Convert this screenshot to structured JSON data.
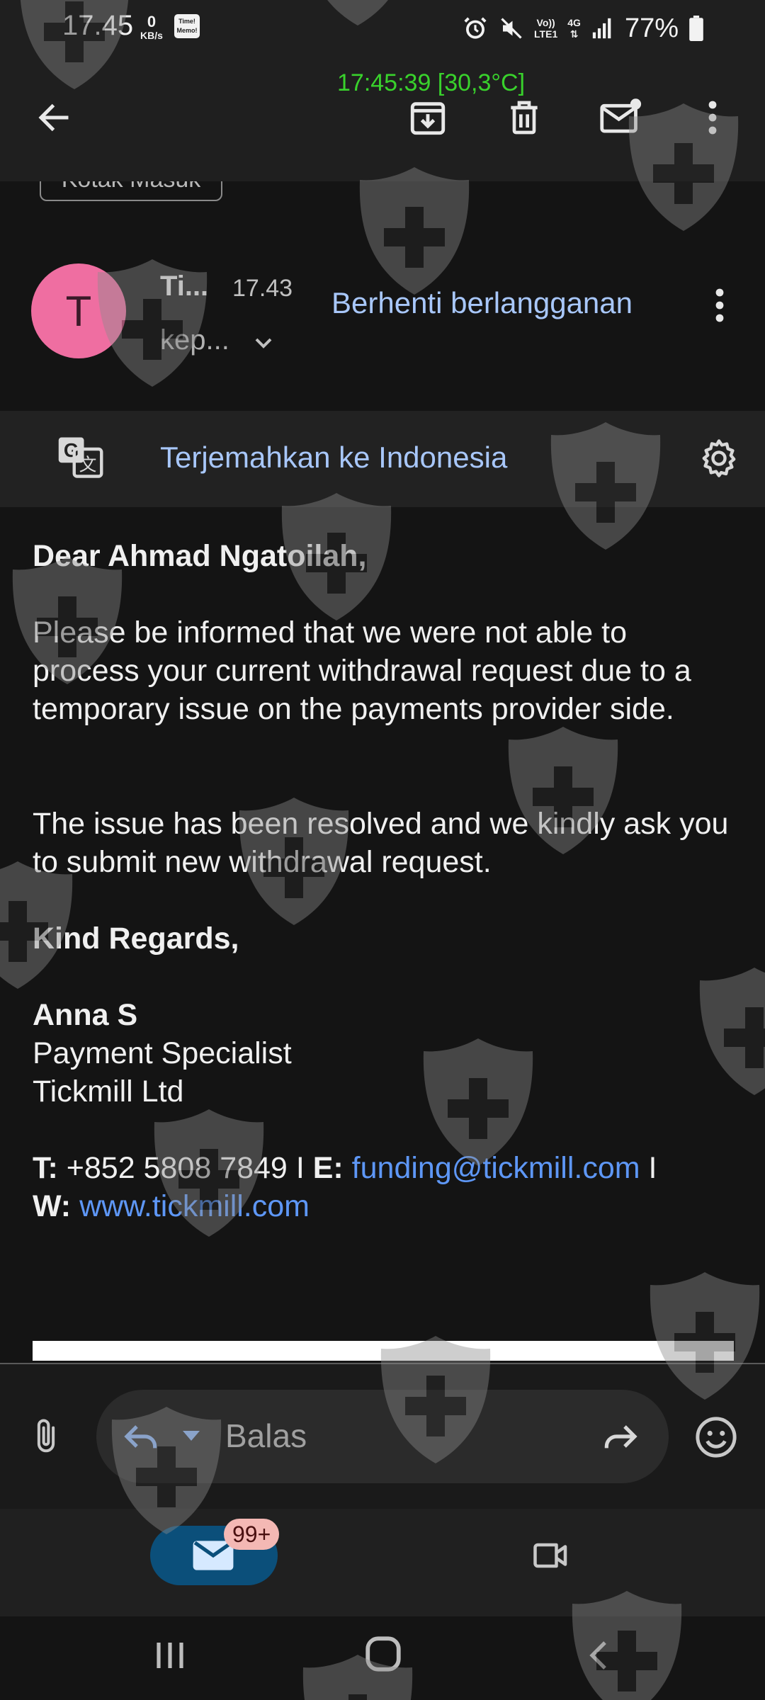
{
  "status_bar": {
    "time": "17.45",
    "speed_value": "0",
    "speed_unit": "KB/s",
    "memo_line1": "Time!",
    "memo_line2": "Memo!",
    "net_volte": "Vo))",
    "net_lte": "LTE1",
    "net_4g": "4G",
    "battery": "77%"
  },
  "overlay_clock": "17:45:39 [30,3°C]",
  "toolbar": {
    "back_icon": "arrow-left-icon",
    "archive_icon": "archive-download-icon",
    "delete_icon": "trash-icon",
    "mark_unread_icon": "mail-unread-icon",
    "more_icon": "more-vert-icon"
  },
  "label_chip": "Kotak Masuk",
  "sender": {
    "avatar_letter": "T",
    "avatar_color": "#ef6ea1",
    "name": "Ti...",
    "time": "17.43",
    "recipient": "kep...",
    "unsubscribe": "Berhenti berlangganan"
  },
  "translate": {
    "link": "Terjemahkan ke Indonesia"
  },
  "email": {
    "greeting": "Dear Ahmad Ngatoilah,",
    "para1": "Please be informed that we were not able to process your current withdrawal request due to a temporary issue on the payments provider side.",
    "para2": "The issue has been resolved and we kindly ask you to submit new withdrawal request.",
    "closing": "Kind Regards,",
    "sig_name": "Anna S",
    "sig_title": "Payment Specialist",
    "sig_company": "Tickmill Ltd",
    "t_label": "T:",
    "phone": "+852 5808 7849",
    "sep1": "I",
    "e_label": "E:",
    "email_addr": "funding@tickmill.com",
    "sep2": "I",
    "w_label": "W:",
    "website": "www.tickmill.com"
  },
  "reply_bar": {
    "placeholder": "Balas"
  },
  "bottom_nav": {
    "mail_badge": "99+"
  },
  "colors": {
    "accent_link": "#a8c7fa",
    "body_link": "#5e97f6",
    "overlay_clock": "#39d22c",
    "mail_pill": "#0b4f7a",
    "badge": "#f4b8b4"
  }
}
